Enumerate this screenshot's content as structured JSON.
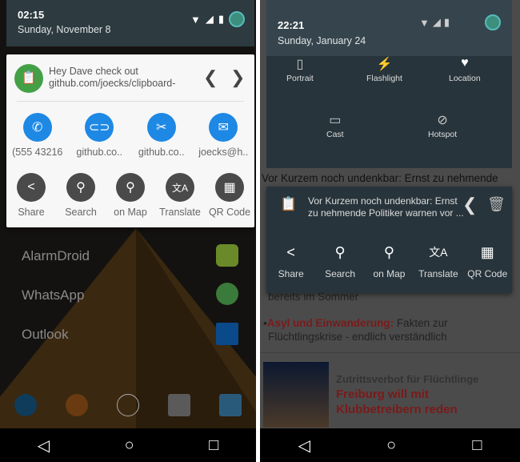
{
  "left": {
    "status": {
      "time": "02:15",
      "date": "Sunday, November 8"
    },
    "clip": {
      "line1": "Hey Dave check out",
      "line2": "github.com/joecks/clipboard-",
      "prev": "❮",
      "next": "❯"
    },
    "smart_actions": [
      {
        "label": "(555 43216",
        "icon": "phone-icon",
        "glyph": "✆"
      },
      {
        "label": "github.co..",
        "icon": "link-icon",
        "glyph": "⊂⊃"
      },
      {
        "label": "github.co..",
        "icon": "cut-link-icon",
        "glyph": "✂"
      },
      {
        "label": "joecks@h..",
        "icon": "email-icon",
        "glyph": "✉"
      }
    ],
    "actions": [
      {
        "label": "Share",
        "icon": "share-icon",
        "glyph": "<"
      },
      {
        "label": "Search",
        "icon": "search-icon",
        "glyph": "⚲"
      },
      {
        "label": "on Map",
        "icon": "map-pin-icon",
        "glyph": "⚲"
      },
      {
        "label": "Translate",
        "icon": "translate-icon",
        "glyph": "文A"
      },
      {
        "label": "QR Code",
        "icon": "qr-code-icon",
        "glyph": "▦"
      }
    ],
    "apps": [
      "AlarmDroid",
      "WhatsApp",
      "Outlook"
    ],
    "accent": "#1e88e5",
    "action_color": "#4a4a4a"
  },
  "right": {
    "status": {
      "time": "22:21",
      "date": "Sunday, January 24"
    },
    "quick_settings": [
      "Portrait",
      "Flashlight",
      "Location",
      "Cast",
      "Hotspot"
    ],
    "article_top": "Vor Kurzem noch undenkbar: Ernst zu nehmende",
    "clip": {
      "line1": "Vor Kurzem noch undenkbar: Ernst",
      "line2": "zu nehmende Politiker warnen vor ...",
      "prev": "❮"
    },
    "actions": [
      "Share",
      "Search",
      "on Map",
      "Translate",
      "QR Code"
    ],
    "web": {
      "line1": "bereits im Sommer",
      "bullet_bold": "Asyl und Einwanderung:",
      "bullet_rest": " Fakten zur",
      "bullet_line2": "Flüchtlingskrise - endlich verständlich",
      "teaser_kicker": "Zutrittsverbot für Flüchtlinge",
      "teaser_title1": "Freiburg will mit",
      "teaser_title2": "Klubbetreibern reden"
    },
    "link_color": "#7a1a1a"
  },
  "nav": {
    "back": "◁",
    "home": "○",
    "recents": "□"
  }
}
